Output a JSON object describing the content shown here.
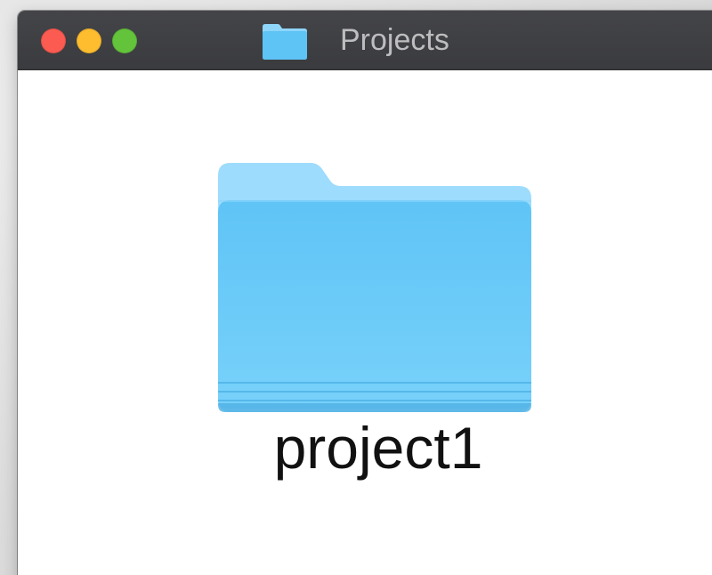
{
  "window": {
    "title": "Projects",
    "title_icon": "folder-icon",
    "controls": {
      "close_color": "#fc5b51",
      "minimize_color": "#fdbd2e",
      "zoom_color": "#63c43c"
    }
  },
  "content": {
    "items": [
      {
        "name": "project1",
        "icon": "folder-icon",
        "color": "#6ccbf8"
      }
    ]
  }
}
